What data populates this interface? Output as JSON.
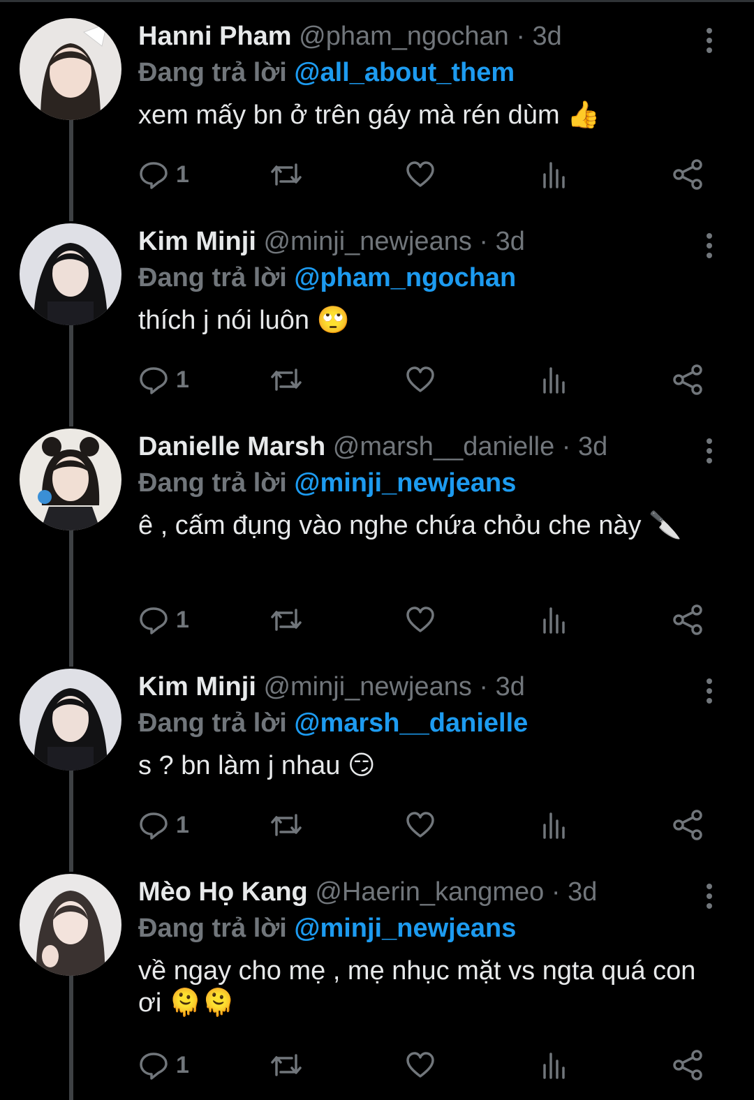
{
  "reply_label": "Đang trả lời",
  "tweets": [
    {
      "name": "Hanni Pham",
      "handle": "@pham_ngochan",
      "separator": "·",
      "time": "3d",
      "reply_to": "@all_about_them",
      "text": "xem mấy bn ở trên gáy mà rén dùm 👍",
      "reply_count": "1"
    },
    {
      "name": "Kim Minji",
      "handle": "@minji_newjeans",
      "separator": "·",
      "time": "3d",
      "reply_to": "@pham_ngochan",
      "text": "thích j nói luôn 🙄",
      "reply_count": "1"
    },
    {
      "name": "Danielle Marsh",
      "handle": "@marsh__danielle",
      "separator": "·",
      "time": "3d",
      "reply_to": "@minji_newjeans",
      "text": "ê , cấm đụng vào nghe chứa chỏu che này 🔪",
      "reply_count": "1"
    },
    {
      "name": "Kim Minji",
      "handle": "@minji_newjeans",
      "separator": "·",
      "time": "3d",
      "reply_to": "@marsh__danielle",
      "text": "s ? bn làm j nhau 😏",
      "reply_count": "1"
    },
    {
      "name": "Mèo Họ Kang",
      "handle": "@Haerin_kangmeo",
      "separator": "·",
      "time": "3d",
      "reply_to": "@minji_newjeans",
      "text": "về ngay cho mẹ , mẹ nhục mặt vs ngta quá con ơi 🫠🫠",
      "reply_count": "1"
    }
  ],
  "icons": {
    "reply": "reply-icon",
    "retweet": "retweet-icon",
    "like": "heart-icon",
    "views": "views-icon",
    "share": "share-icon",
    "more": "more-vertical-icon"
  },
  "colors": {
    "background": "#000000",
    "text": "#e7e9ea",
    "secondary": "#71767b",
    "mention": "#1d9bf0",
    "thread_line": "#3e4144"
  }
}
